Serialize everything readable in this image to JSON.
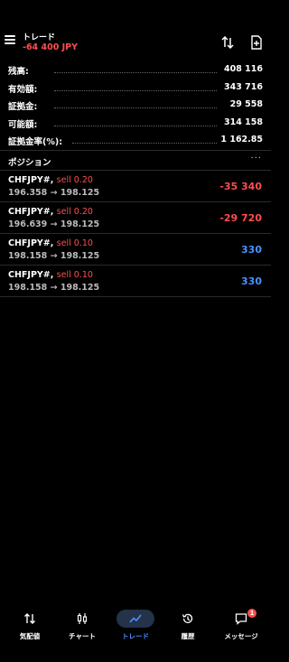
{
  "header": {
    "title": "トレード",
    "pnl": "-64 400 JPY"
  },
  "summary": [
    {
      "label": "残高:",
      "value": "408 116"
    },
    {
      "label": "有効額:",
      "value": "343 716"
    },
    {
      "label": "証拠金:",
      "value": "29 558"
    },
    {
      "label": "可能額:",
      "value": "314 158"
    },
    {
      "label": "証拠金率(%):",
      "value": "1 162.85"
    }
  ],
  "positions_section": {
    "title": "ポジション",
    "more": "···"
  },
  "positions": [
    {
      "symbol": "CHFJPY#,",
      "side": "sell 0.20",
      "prices": "196.358 → 198.125",
      "profit": "-35 340",
      "profit_color": "#ff4d4d"
    },
    {
      "symbol": "CHFJPY#,",
      "side": "sell 0.20",
      "prices": "196.639 → 198.125",
      "profit": "-29 720",
      "profit_color": "#ff4d4d"
    },
    {
      "symbol": "CHFJPY#,",
      "side": "sell 0.10",
      "prices": "198.158 → 198.125",
      "profit": "330",
      "profit_color": "#4a90ff"
    },
    {
      "symbol": "CHFJPY#,",
      "side": "sell 0.10",
      "prices": "198.158 → 198.125",
      "profit": "330",
      "profit_color": "#4a90ff"
    }
  ],
  "tabbar": {
    "active": "trade",
    "tabs": [
      {
        "id": "quotes",
        "label": "気配値",
        "icon": "arrows-updown-icon"
      },
      {
        "id": "chart",
        "label": "チャート",
        "icon": "candlestick-icon"
      },
      {
        "id": "trade",
        "label": "トレード",
        "icon": "trend-line-icon"
      },
      {
        "id": "history",
        "label": "履歴",
        "icon": "history-icon"
      },
      {
        "id": "messages",
        "label": "メッセージ",
        "icon": "message-icon",
        "badge": "1"
      }
    ]
  },
  "colors": {
    "background": "#000000",
    "loss": "#ff4d4d",
    "profit": "#4a90ff",
    "accent": "#4a90ff"
  }
}
